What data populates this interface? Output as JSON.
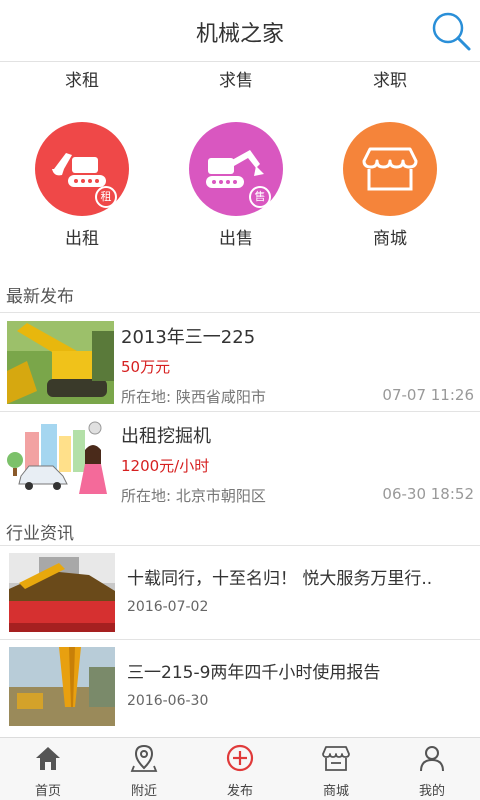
{
  "header": {
    "title": "机械之家",
    "search_icon": "search-icon"
  },
  "quick_links": [
    "求租",
    "求售",
    "求职"
  ],
  "categories": [
    {
      "label": "出租",
      "badge": "租",
      "color": "#ef4848",
      "icon": "excavator-icon"
    },
    {
      "label": "出售",
      "badge": "售",
      "color": "#d957c0",
      "icon": "excavator-icon"
    },
    {
      "label": "商城",
      "color": "#f5843a",
      "icon": "shop-icon"
    }
  ],
  "latest": {
    "title": "最新发布",
    "items": [
      {
        "title": "2013年三一225",
        "price": "50万元",
        "location": "所在地: 陕西省咸阳市",
        "time": "07-07 11:26"
      },
      {
        "title": "出租挖掘机",
        "price": "1200元/小时",
        "location": "所在地: 北京市朝阳区",
        "time": "06-30 18:52"
      }
    ]
  },
  "news": {
    "title": "行业资讯",
    "items": [
      {
        "title": "十载同行，十至名归！ 悦大服务万里行..",
        "date": "2016-07-02"
      },
      {
        "title": "三一215-9两年四千小时使用报告",
        "date": "2016-06-30"
      }
    ]
  },
  "tabs": [
    {
      "label": "首页",
      "icon": "home-icon"
    },
    {
      "label": "附近",
      "icon": "location-pin-icon"
    },
    {
      "label": "发布",
      "icon": "plus-circle-icon",
      "color": "#e03a3a"
    },
    {
      "label": "商城",
      "icon": "shop-icon"
    },
    {
      "label": "我的",
      "icon": "user-icon"
    }
  ]
}
